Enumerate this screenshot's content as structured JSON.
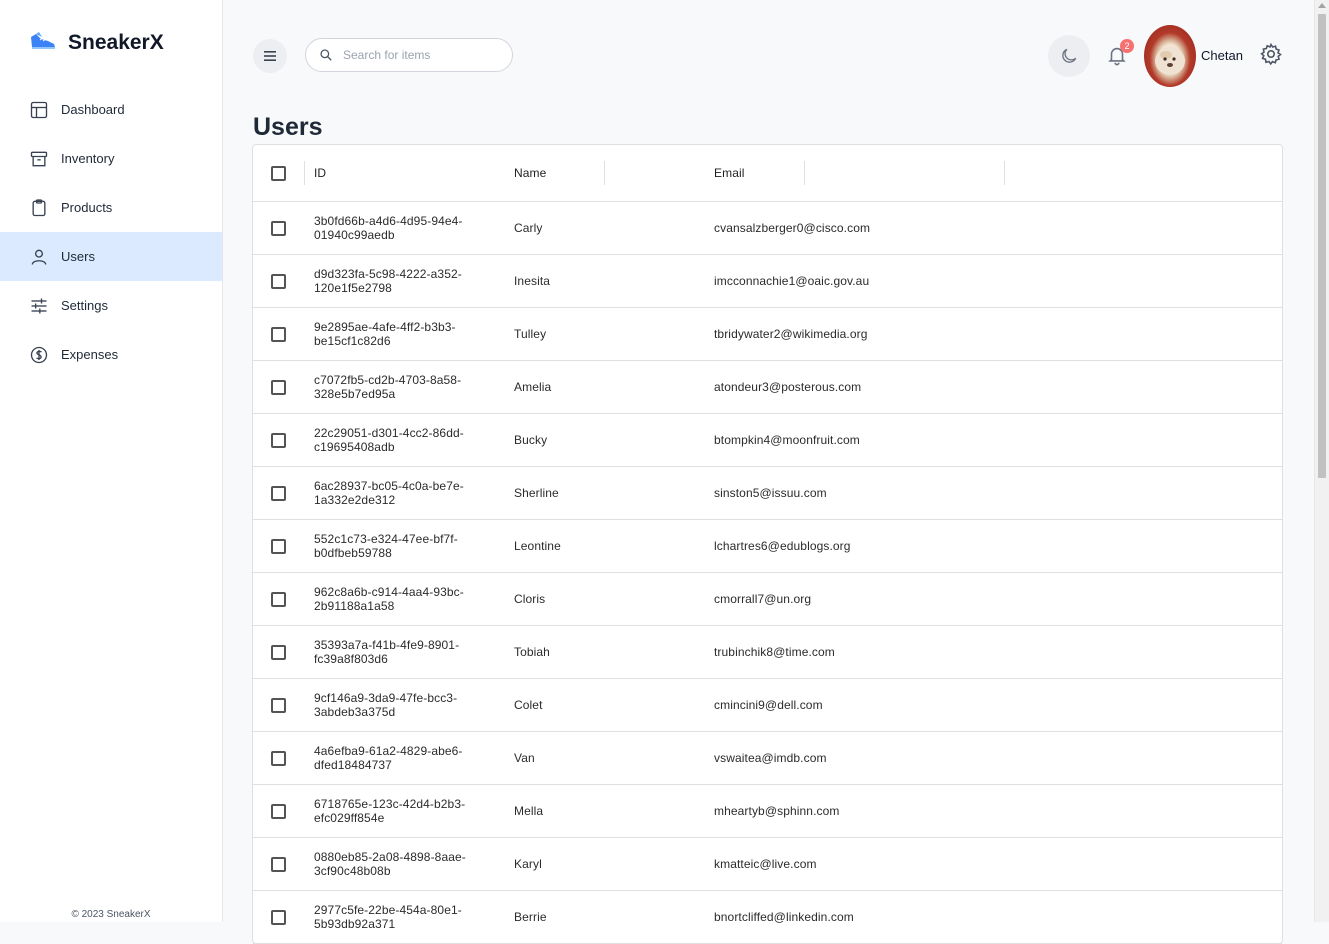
{
  "brand": {
    "name": "SneakerX"
  },
  "sidebar": {
    "items": [
      {
        "label": "Dashboard",
        "icon": "dashboard-icon"
      },
      {
        "label": "Inventory",
        "icon": "archive-icon"
      },
      {
        "label": "Products",
        "icon": "clipboard-icon"
      },
      {
        "label": "Users",
        "icon": "user-icon",
        "active": true
      },
      {
        "label": "Settings",
        "icon": "sliders-icon"
      },
      {
        "label": "Expenses",
        "icon": "dollar-icon"
      }
    ],
    "footer": "© 2023 SneakerX"
  },
  "topbar": {
    "search_placeholder": "Search for items",
    "notifications_count": "2",
    "user_name": "Chetan"
  },
  "page": {
    "title": "Users"
  },
  "table": {
    "columns": [
      "ID",
      "Name",
      "Email"
    ],
    "rows": [
      {
        "id": "3b0fd66b-a4d6-4d95-94e4-01940c99aedb",
        "name": "Carly",
        "email": "cvansalzberger0@cisco.com"
      },
      {
        "id": "d9d323fa-5c98-4222-a352-120e1f5e2798",
        "name": "Inesita",
        "email": "imcconnachie1@oaic.gov.au"
      },
      {
        "id": "9e2895ae-4afe-4ff2-b3b3-be15cf1c82d6",
        "name": "Tulley",
        "email": "tbridywater2@wikimedia.org"
      },
      {
        "id": "c7072fb5-cd2b-4703-8a58-328e5b7ed95a",
        "name": "Amelia",
        "email": "atondeur3@posterous.com"
      },
      {
        "id": "22c29051-d301-4cc2-86dd-c19695408adb",
        "name": "Bucky",
        "email": "btompkin4@moonfruit.com"
      },
      {
        "id": "6ac28937-bc05-4c0a-be7e-1a332e2de312",
        "name": "Sherline",
        "email": "sinston5@issuu.com"
      },
      {
        "id": "552c1c73-e324-47ee-bf7f-b0dfbeb59788",
        "name": "Leontine",
        "email": "lchartres6@edublogs.org"
      },
      {
        "id": "962c8a6b-c914-4aa4-93bc-2b91188a1a58",
        "name": "Cloris",
        "email": "cmorrall7@un.org"
      },
      {
        "id": "35393a7a-f41b-4fe9-8901-fc39a8f803d6",
        "name": "Tobiah",
        "email": "trubinchik8@time.com"
      },
      {
        "id": "9cf146a9-3da9-47fe-bcc3-3abdeb3a375d",
        "name": "Colet",
        "email": "cmincini9@dell.com"
      },
      {
        "id": "4a6efba9-61a2-4829-abe6-dfed18484737",
        "name": "Van",
        "email": "vswaitea@imdb.com"
      },
      {
        "id": "6718765e-123c-42d4-b2b3-efc029ff854e",
        "name": "Mella",
        "email": "mheartyb@sphinn.com"
      },
      {
        "id": "0880eb85-2a08-4898-8aae-3cf90c48b08b",
        "name": "Karyl",
        "email": "kmatteic@live.com"
      },
      {
        "id": "2977c5fe-22be-454a-80e1-5b93db92a371",
        "name": "Berrie",
        "email": "bnortcliffed@linkedin.com"
      }
    ]
  }
}
